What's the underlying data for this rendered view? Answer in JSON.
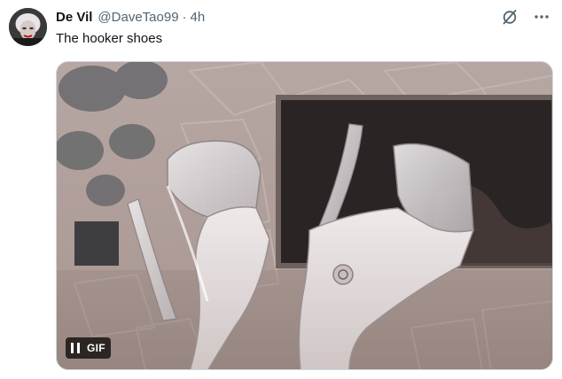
{
  "tweet": {
    "author": {
      "display_name": "De Vil",
      "handle": "@DaveTao99",
      "separator": "·",
      "time": "4h"
    },
    "text": "The hooker shoes",
    "media": {
      "type": "gif",
      "badge_label": "GIF",
      "playback_state": "playing"
    },
    "actions": {
      "grok_icon": "grok-slash-icon",
      "more_icon": "more-horizontal-icon"
    }
  },
  "colors": {
    "text_primary": "#0f1419",
    "text_secondary": "#536471",
    "border": "#cfd9de"
  }
}
